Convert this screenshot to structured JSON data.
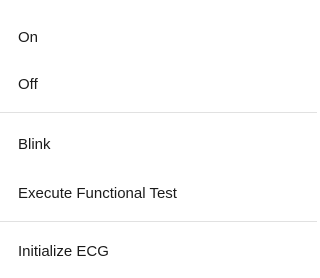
{
  "menu": {
    "groups": [
      {
        "items": [
          {
            "label": "On"
          },
          {
            "label": "Off"
          }
        ]
      },
      {
        "items": [
          {
            "label": "Blink"
          },
          {
            "label": "Execute Functional Test"
          }
        ]
      },
      {
        "items": [
          {
            "label": "Initialize ECG"
          }
        ]
      }
    ]
  }
}
